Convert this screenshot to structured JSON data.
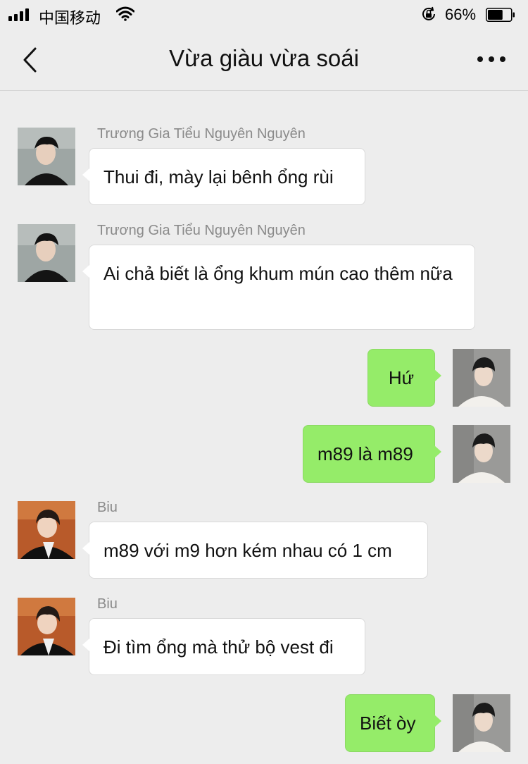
{
  "status_bar": {
    "carrier": "中国移动",
    "battery_percent": "66%",
    "battery_level": 0.66,
    "icons": [
      "signal-icon",
      "wifi-icon",
      "rotation-lock-icon",
      "battery-icon"
    ]
  },
  "nav": {
    "title": "Vừa giàu vừa soái",
    "icons": [
      "back-icon",
      "more-icon"
    ]
  },
  "colors": {
    "background": "#ededed",
    "incoming_bubble": "#ffffff",
    "outgoing_bubble": "#95ec69",
    "sender_name": "#8a8a8a"
  },
  "messages": [
    {
      "direction": "in",
      "sender": "Trương Gia Tiểu Nguyên Nguyên",
      "text": "Thui đi, mày lại bênh ổng rùi"
    },
    {
      "direction": "in",
      "sender": "Trương Gia Tiểu Nguyên Nguyên",
      "text": "Ai chả biết là ổng khum mún cao thêm nữa"
    },
    {
      "direction": "out",
      "sender": "",
      "text": "Hứ"
    },
    {
      "direction": "out",
      "sender": "",
      "text": "m89 là m89"
    },
    {
      "direction": "in",
      "sender": "Biu",
      "text": "m89 với m9 hơn kém nhau có 1 cm"
    },
    {
      "direction": "in",
      "sender": "Biu",
      "text": "Đi tìm ổng mà thử bộ vest đi"
    },
    {
      "direction": "out",
      "sender": "",
      "text": "Biết òy"
    }
  ]
}
